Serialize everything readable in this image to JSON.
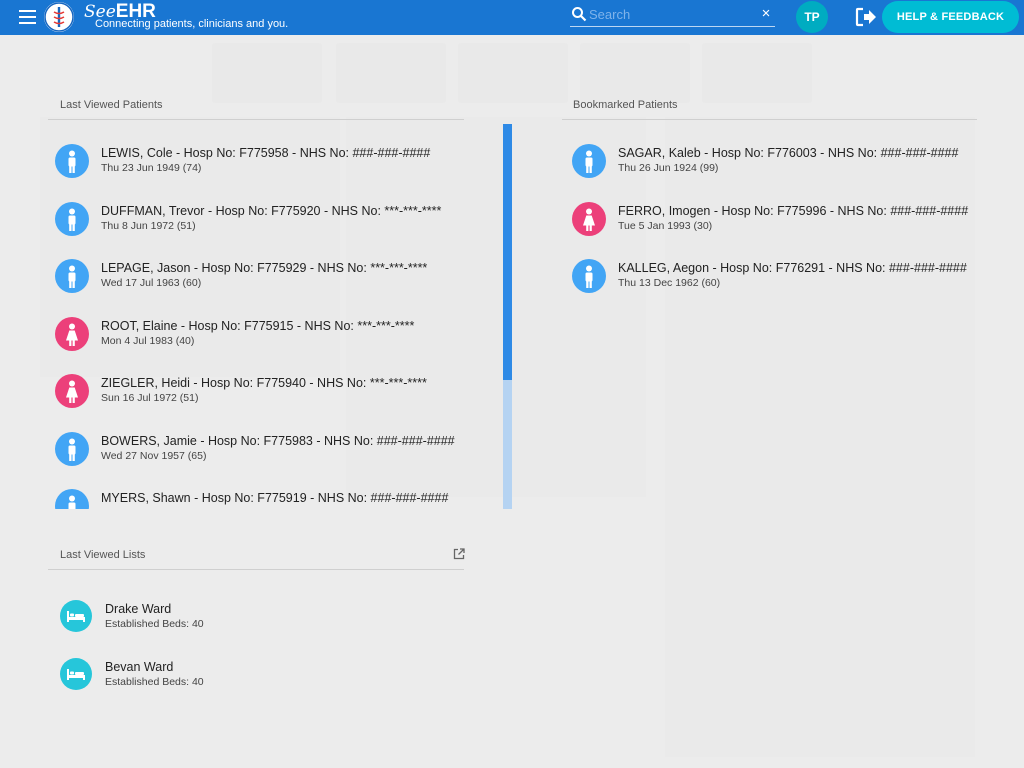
{
  "header": {
    "brand_see": "See",
    "brand_ehr": "EHR",
    "tagline": "Connecting patients, clinicians and you.",
    "search_placeholder": "Search",
    "search_clear": "×",
    "user_initials": "TP",
    "help_label": "HELP & FEEDBACK",
    "colors": {
      "bar": "#1976d2",
      "accent": "#00bcd4"
    }
  },
  "last_viewed_patients": {
    "title": "Last Viewed Patients",
    "patients": [
      {
        "name": "LEWIS, Cole - Hosp No: F775958 - NHS No: ###-###-####",
        "dob": "Thu 23 Jun 1949 (74)",
        "sex": "male"
      },
      {
        "name": "DUFFMAN, Trevor - Hosp No: F775920 - NHS No: ***-***-****",
        "dob": "Thu 8 Jun 1972 (51)",
        "sex": "male"
      },
      {
        "name": "LEPAGE, Jason - Hosp No: F775929 - NHS No: ***-***-****",
        "dob": "Wed 17 Jul 1963 (60)",
        "sex": "male"
      },
      {
        "name": "ROOT, Elaine - Hosp No: F775915 - NHS No: ***-***-****",
        "dob": "Mon 4 Jul 1983 (40)",
        "sex": "female"
      },
      {
        "name": "ZIEGLER, Heidi - Hosp No: F775940 - NHS No: ***-***-****",
        "dob": "Sun 16 Jul 1972 (51)",
        "sex": "female"
      },
      {
        "name": "BOWERS, Jamie - Hosp No: F775983 - NHS No: ###-###-####",
        "dob": "Wed 27 Nov 1957 (65)",
        "sex": "male"
      },
      {
        "name": "MYERS, Shawn - Hosp No: F775919 - NHS No: ###-###-####",
        "dob": "",
        "sex": "male"
      }
    ]
  },
  "bookmarked_patients": {
    "title": "Bookmarked Patients",
    "patients": [
      {
        "name": "SAGAR, Kaleb - Hosp No: F776003 - NHS No: ###-###-####",
        "dob": "Thu 26 Jun 1924 (99)",
        "sex": "male"
      },
      {
        "name": "FERRO, Imogen - Hosp No: F775996 - NHS No: ###-###-####",
        "dob": "Tue 5 Jan 1993 (30)",
        "sex": "female"
      },
      {
        "name": "KALLEG, Aegon - Hosp No: F776291 - NHS No: ###-###-####",
        "dob": "Thu 13 Dec 1962 (60)",
        "sex": "male"
      }
    ]
  },
  "last_viewed_lists": {
    "title": "Last Viewed Lists",
    "lists": [
      {
        "name": "Drake Ward",
        "beds": "Established Beds: 40"
      },
      {
        "name": "Bevan Ward",
        "beds": "Established Beds: 40"
      }
    ]
  }
}
